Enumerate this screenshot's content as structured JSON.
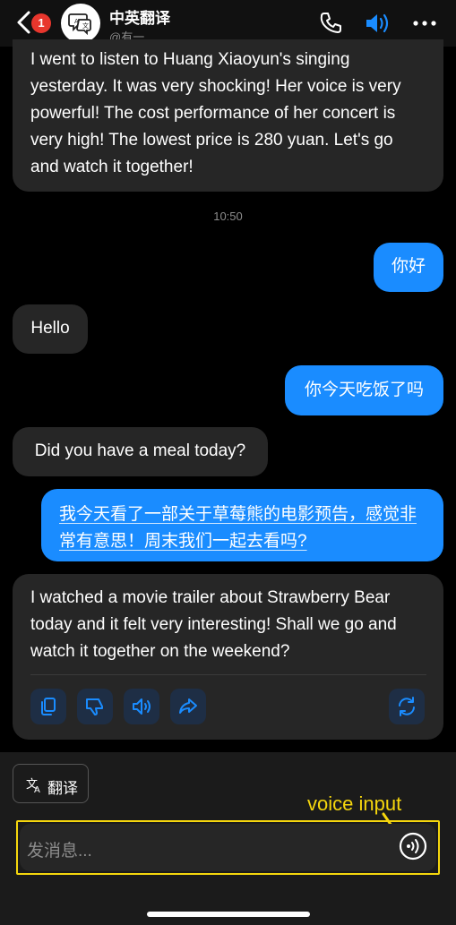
{
  "header": {
    "badge": "1",
    "title": "中英翻译",
    "subtitle": "@有一"
  },
  "messages": {
    "m1": "I went to listen to Huang Xiaoyun's singing yesterday. It was very shocking! Her voice is very powerful! The cost performance of her concert is very high! The lowest price is 280 yuan. Let's go and watch it together!",
    "time": "10:50",
    "m2": "你好",
    "m3": "Hello",
    "m4": "你今天吃饭了吗",
    "m5": "Did you have a meal today?",
    "m6": "我今天看了一部关于草莓熊的电影预告，感觉非常有意思！周末我们一起去看吗?",
    "m7": "I watched a movie trailer about Strawberry Bear today and it felt very interesting! Shall we go and watch it together on the weekend?"
  },
  "bottom": {
    "translate_label": "翻译",
    "input_placeholder": "发消息...",
    "annotation": "voice input"
  },
  "colors": {
    "accent": "#1a8cff",
    "badge": "#e8362d",
    "annotation": "#f5d60d"
  }
}
